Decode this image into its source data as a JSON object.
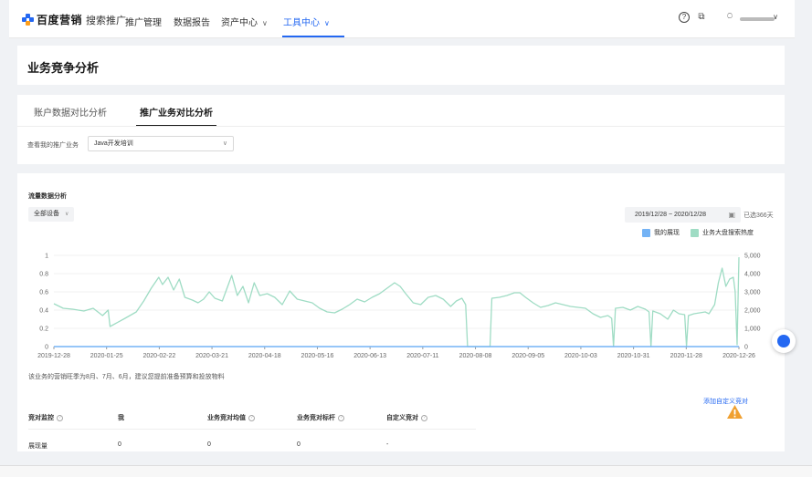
{
  "nav": {
    "brand": "百度营销",
    "brand_sub": "搜索推广",
    "items": [
      {
        "label": "推广管理"
      },
      {
        "label": "数据报告"
      },
      {
        "label": "资产中心"
      },
      {
        "label": "工具中心"
      }
    ],
    "active_item": "工具中心",
    "icons": [
      "help-icon",
      "copy-icon",
      "user-icon",
      "chevron-down-icon"
    ]
  },
  "page": {
    "title": "业务竞争分析"
  },
  "tabs": [
    {
      "label": "账户数据对比分析"
    },
    {
      "label": "推广业务对比分析"
    }
  ],
  "filter": {
    "label": "查看我的推广业务",
    "value": "Java开发培训"
  },
  "traffic": {
    "title": "流量数据分析",
    "device": "全部设备",
    "date_range": "2019/12/28 ~ 2020/12/28",
    "days": "已选366天",
    "note": "该业务的营销旺季为8月、7月、6月，建议您提前准备预算和投放物料"
  },
  "table": {
    "add_link": "添加自定义竞对",
    "headers": [
      "竞对监控",
      "我",
      "业务竞对均值",
      "业务竞对标杆",
      "自定义竞对"
    ],
    "rows": [
      {
        "metric": "展现量",
        "me": "0",
        "avg": "0",
        "benchmark": "0",
        "custom": "-"
      }
    ]
  },
  "colors": {
    "accent": "#2468f2",
    "series_mine": "#74b3f5",
    "series_market": "#9fdcc4",
    "warning": "#f0a030"
  },
  "chart_data": {
    "type": "line",
    "x_tick_labels": [
      "2019-12-28",
      "2020-01-25",
      "2020-02-22",
      "2020-03-21",
      "2020-04-18",
      "2020-05-16",
      "2020-06-13",
      "2020-07-11",
      "2020-08-08",
      "2020-09-05",
      "2020-10-03",
      "2020-10-31",
      "2020-11-28",
      "2020-12-26"
    ],
    "y_left_ticks": [
      "0",
      "0.2",
      "0.4",
      "0.6",
      "0.8",
      "1"
    ],
    "y_right_ticks": [
      "0",
      "1,000",
      "2,000",
      "3,000",
      "4,000",
      "5,000"
    ],
    "ylim_left": [
      0,
      1
    ],
    "ylim_right": [
      0,
      5000
    ],
    "x_range_days": [
      0,
      366
    ],
    "legend": "top-right",
    "series": [
      {
        "name": "我的展现",
        "axis": "left",
        "points": [
          [
            0,
            0
          ],
          [
            366,
            0
          ]
        ]
      },
      {
        "name": "业务大盘搜索热度",
        "axis": "right",
        "points": [
          [
            0,
            2350
          ],
          [
            5,
            2100
          ],
          [
            10,
            2050
          ],
          [
            16,
            1950
          ],
          [
            21,
            2100
          ],
          [
            26,
            1700
          ],
          [
            29,
            2000
          ],
          [
            30,
            1100
          ],
          [
            38,
            1550
          ],
          [
            44,
            1900
          ],
          [
            48,
            2500
          ],
          [
            52,
            3200
          ],
          [
            56,
            3800
          ],
          [
            58,
            3400
          ],
          [
            61,
            3800
          ],
          [
            64,
            3100
          ],
          [
            67,
            3700
          ],
          [
            70,
            2700
          ],
          [
            74,
            2550
          ],
          [
            77,
            2400
          ],
          [
            80,
            2600
          ],
          [
            83,
            3000
          ],
          [
            86,
            2650
          ],
          [
            90,
            2500
          ],
          [
            95,
            3900
          ],
          [
            98,
            2800
          ],
          [
            101,
            3300
          ],
          [
            104,
            2400
          ],
          [
            107,
            3500
          ],
          [
            110,
            2800
          ],
          [
            114,
            2900
          ],
          [
            118,
            2700
          ],
          [
            122,
            2300
          ],
          [
            126,
            3050
          ],
          [
            130,
            2600
          ],
          [
            134,
            2500
          ],
          [
            138,
            2400
          ],
          [
            142,
            2100
          ],
          [
            146,
            1900
          ],
          [
            150,
            1850
          ],
          [
            154,
            2050
          ],
          [
            158,
            2300
          ],
          [
            162,
            2600
          ],
          [
            166,
            2450
          ],
          [
            170,
            2700
          ],
          [
            174,
            2900
          ],
          [
            178,
            3200
          ],
          [
            182,
            3500
          ],
          [
            185,
            3300
          ],
          [
            188,
            2900
          ],
          [
            192,
            2400
          ],
          [
            196,
            2300
          ],
          [
            200,
            2700
          ],
          [
            204,
            2800
          ],
          [
            208,
            2600
          ],
          [
            212,
            2200
          ],
          [
            215,
            2500
          ],
          [
            218,
            2650
          ],
          [
            220,
            2300
          ],
          [
            221,
            0
          ],
          [
            233,
            0
          ],
          [
            234,
            2650
          ],
          [
            238,
            2700
          ],
          [
            242,
            2800
          ],
          [
            246,
            2950
          ],
          [
            249,
            2950
          ],
          [
            252,
            2700
          ],
          [
            256,
            2400
          ],
          [
            260,
            2150
          ],
          [
            264,
            2250
          ],
          [
            268,
            2400
          ],
          [
            272,
            2300
          ],
          [
            276,
            2200
          ],
          [
            280,
            2150
          ],
          [
            284,
            2100
          ],
          [
            288,
            1800
          ],
          [
            292,
            1600
          ],
          [
            296,
            1700
          ],
          [
            298,
            1550
          ],
          [
            299,
            0
          ],
          [
            300,
            2100
          ],
          [
            304,
            2150
          ],
          [
            308,
            2000
          ],
          [
            312,
            2200
          ],
          [
            316,
            2050
          ],
          [
            318,
            1900
          ],
          [
            319,
            0
          ],
          [
            320,
            1950
          ],
          [
            324,
            1800
          ],
          [
            328,
            1500
          ],
          [
            331,
            2000
          ],
          [
            334,
            1800
          ],
          [
            337,
            1750
          ],
          [
            338,
            0
          ],
          [
            339,
            1700
          ],
          [
            342,
            1800
          ],
          [
            345,
            1850
          ],
          [
            348,
            1900
          ],
          [
            350,
            1800
          ],
          [
            353,
            2300
          ],
          [
            355,
            3500
          ],
          [
            357,
            4300
          ],
          [
            359,
            3300
          ],
          [
            361,
            3700
          ],
          [
            363,
            3800
          ],
          [
            364,
            3000
          ],
          [
            365,
            100
          ],
          [
            366,
            4900
          ]
        ]
      }
    ]
  }
}
